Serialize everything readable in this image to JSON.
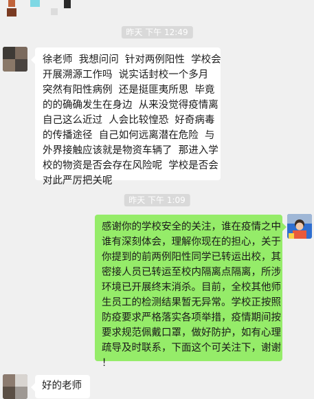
{
  "timestamps": [
    "昨天 下午 12:49",
    "昨天 下午 1:09"
  ],
  "messages": {
    "incoming_1": "徐老师  我想问问  针对两例阳性  学校会\n开展溯源工作吗  说实话封校一个多月\n突然有阳性病例  还是挺匪夷所思  毕竟\n的的确确发生在身边  从来没觉得疫情离\n自己这么近过  人会比较惶恐  好奇病毒\n的传播途径  自己如何远离潜在危险  与\n外界接触应该就是物资车辆了  那进入学\n校的物资是否会存在风险呢  学校是否会\n对此严厉把关呢",
    "outgoing_1": "感谢你的学校安全的关注，谁在疫情之中\n谁有深刻体会，理解你现在的担心，关于\n你提到的前两例阳性同学已转运出校，其\n密接人员已转运至校内隔离点隔离，所涉\n环境已开展终末消杀。目前，全校其他师\n生员工的检测结果暂无异常。学校正按照\n防疫要求严格落实各项举措，疫情期间按\n要求规范佩戴口罩，做好防护，如有心理\n疏导及时联系，下面这个可关注下，谢谢\n！",
    "incoming_2": "好的老师"
  },
  "colors": {
    "background": "#f0f0f0",
    "outgoing_bubble": "#95ec69",
    "incoming_bubble": "#ffffff",
    "timestamp_bg": "#d9d9d9"
  }
}
